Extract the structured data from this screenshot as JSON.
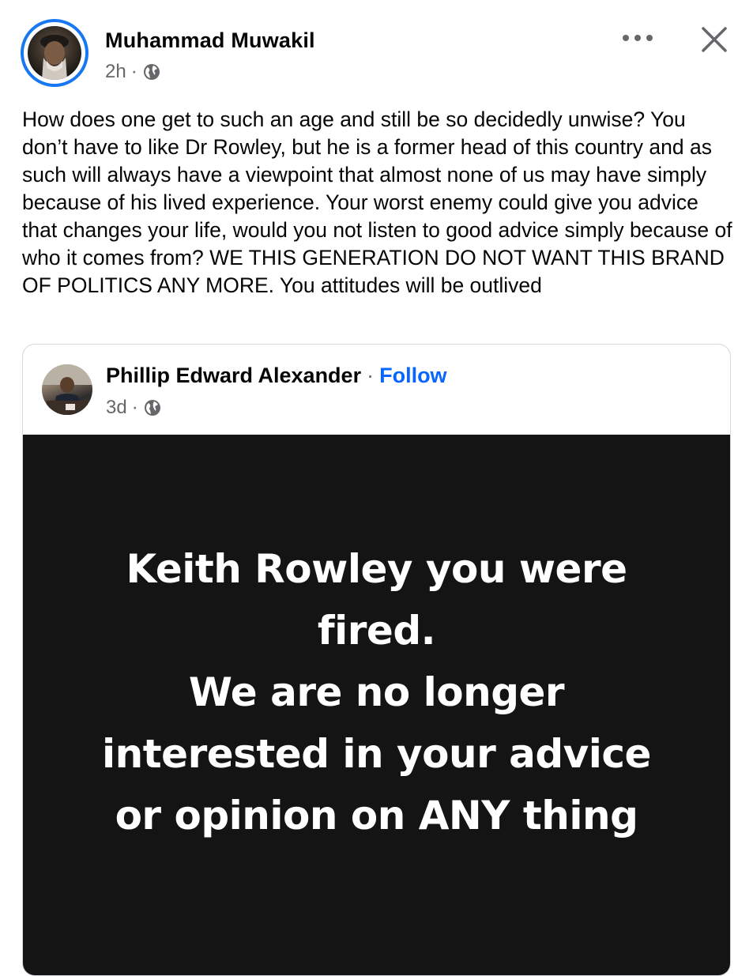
{
  "post": {
    "author": "Muhammad Muwakil",
    "time": "2h",
    "meta_separator": "·",
    "text": "How does one get to such an age and still be so decidedly unwise? You don’t have to like Dr Rowley, but he is a former head of this country and as such will always have a viewpoint that almost none of us may have simply because of his lived experience. Your worst enemy could give you advice that changes your life, would you not listen to good advice simply because of who it comes from? WE THIS GENERATION DO NOT WANT THIS BRAND OF POLITICS ANY MORE. You attitudes will be outlived"
  },
  "shared_post": {
    "author": "Phillip Edward Alexander",
    "separator": "·",
    "follow_label": "Follow",
    "time": "3d",
    "meta_separator": "·",
    "image_text_lines": [
      "Keith Rowley you were",
      "fired.",
      "We are no longer",
      "interested in your advice",
      "or opinion on ANY thing"
    ]
  },
  "icons": {
    "more": "more-horizontal-icon",
    "close": "close-icon",
    "privacy": "globe-icon"
  },
  "colors": {
    "accent_blue": "#1877f2",
    "link_blue": "#0866ff",
    "secondary_text": "#65676b",
    "panel_bg": "#141414"
  }
}
